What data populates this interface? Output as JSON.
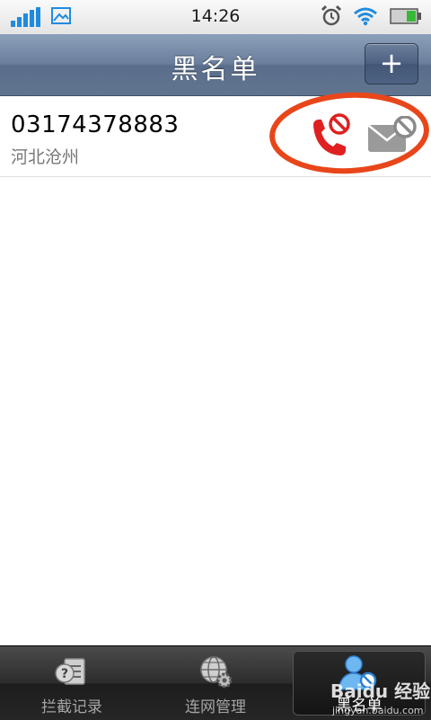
{
  "status_bar": {
    "time": "14:26"
  },
  "header": {
    "title": "黑名单",
    "add_label": "+"
  },
  "blacklist": [
    {
      "number": "03174378883",
      "location": "河北沧州"
    }
  ],
  "tabs": [
    {
      "label": "拦截记录"
    },
    {
      "label": "连网管理"
    },
    {
      "label": "黑名单"
    }
  ],
  "watermark": {
    "text": "Baidu 经验",
    "subtext": "jingyan.baidu.com"
  },
  "colors": {
    "title_bar": "#6b7f9d",
    "block_red": "#e02020",
    "annotation_red": "#e8461a",
    "tab_bar": "#262626"
  }
}
